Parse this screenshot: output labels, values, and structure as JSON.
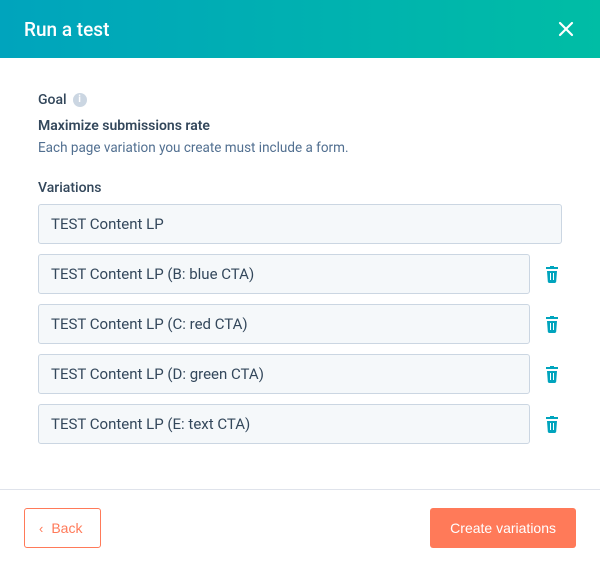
{
  "header": {
    "title": "Run a test"
  },
  "goal": {
    "label": "Goal",
    "value": "Maximize submissions rate",
    "description": "Each page variation you create must include a form."
  },
  "variations": {
    "label": "Variations",
    "items": [
      {
        "name": "TEST Content LP",
        "deletable": false
      },
      {
        "name": "TEST Content LP (B: blue CTA)",
        "deletable": true
      },
      {
        "name": "TEST Content LP (C: red CTA)",
        "deletable": true
      },
      {
        "name": "TEST Content LP (D: green CTA)",
        "deletable": true
      },
      {
        "name": "TEST Content LP (E: text CTA)",
        "deletable": true
      }
    ]
  },
  "footer": {
    "back": "Back",
    "primary": "Create variations"
  }
}
